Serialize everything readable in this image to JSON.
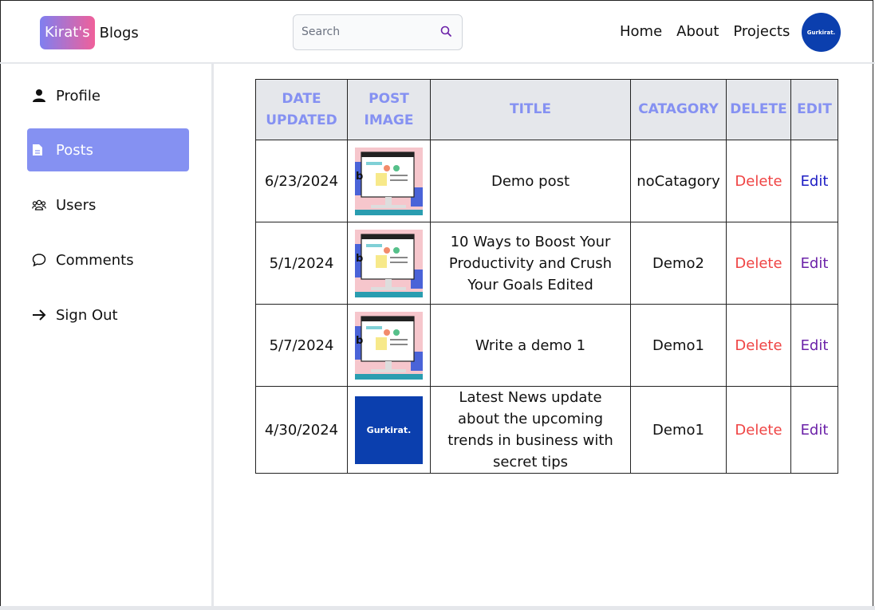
{
  "brand": {
    "badge": "Kirat's",
    "text": "Blogs"
  },
  "search": {
    "placeholder": "Search"
  },
  "nav": {
    "items": [
      "Home",
      "About",
      "Projects"
    ]
  },
  "avatar": {
    "text": "Gurkirat."
  },
  "sidebar": {
    "items": [
      {
        "label": "Profile",
        "icon": "user-icon"
      },
      {
        "label": "Posts",
        "icon": "document-icon"
      },
      {
        "label": "Users",
        "icon": "users-icon"
      },
      {
        "label": "Comments",
        "icon": "comment-icon"
      },
      {
        "label": "Sign Out",
        "icon": "arrow-right-icon"
      }
    ],
    "active": "Posts"
  },
  "table": {
    "headers": [
      "DATE UPDATED",
      "POST IMAGE",
      "TITLE",
      "CATAGORY",
      "DELETE",
      "EDIT"
    ],
    "rows": [
      {
        "date": "6/23/2024",
        "image": "illustration",
        "title": "Demo post",
        "category": "noCatagory",
        "delete": "Delete",
        "edit": "Edit"
      },
      {
        "date": "5/1/2024",
        "image": "illustration",
        "title": "10 Ways to Boost Your Productivity and Crush Your Goals Edited",
        "category": "Demo2",
        "delete": "Delete",
        "edit": "Edit"
      },
      {
        "date": "5/7/2024",
        "image": "illustration",
        "title": "Write a demo 1",
        "category": "Demo1",
        "delete": "Delete",
        "edit": "Edit"
      },
      {
        "date": "4/30/2024",
        "image": "logo",
        "image_text": "Gurkirat.",
        "title": "Latest News update about the upcoming trends in business with secret tips",
        "category": "Demo1",
        "delete": "Delete",
        "edit": "Edit"
      }
    ]
  },
  "colors": {
    "accent": "#8591f2",
    "delete": "#ef4444",
    "edit": "#6b21a8",
    "logo_bg": "#0b3fae"
  }
}
